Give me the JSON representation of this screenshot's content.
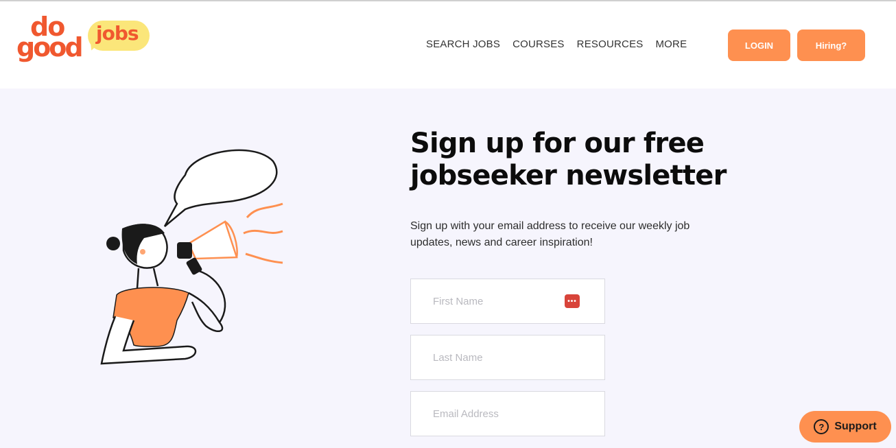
{
  "brand": {
    "logo_do": "do",
    "logo_good": "good",
    "logo_jobs": "jobs",
    "colors": {
      "accent": "#fe9050",
      "logo": "#f0582f",
      "logo_bubble": "#fbe67a",
      "background": "#f6f5fd"
    }
  },
  "nav": {
    "items": [
      {
        "label": "SEARCH JOBS"
      },
      {
        "label": "COURSES"
      },
      {
        "label": "RESOURCES"
      },
      {
        "label": "MORE"
      }
    ]
  },
  "header": {
    "login_label": "LOGIN",
    "hiring_label": "Hiring?"
  },
  "main": {
    "title": "Sign up for our free jobseeker newsletter",
    "description": "Sign up with your email address to receive our weekly job updates, news and career inspiration!",
    "form": {
      "first_name": {
        "placeholder": "First Name",
        "value": ""
      },
      "last_name": {
        "placeholder": "Last Name",
        "value": ""
      },
      "email": {
        "placeholder": "Email Address",
        "value": ""
      },
      "password_manager_icon": "password-manager-icon"
    }
  },
  "support": {
    "label": "Support",
    "icon": "question-icon"
  }
}
